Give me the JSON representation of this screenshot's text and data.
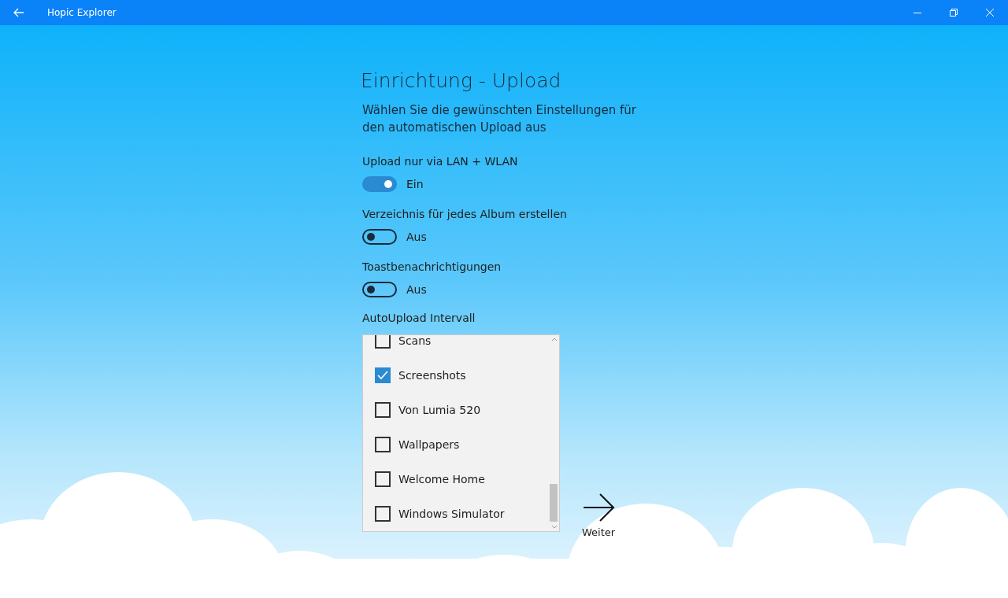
{
  "window": {
    "title": "Hopic Explorer"
  },
  "heading": "Einrichtung - Upload",
  "subtitle": "Wählen Sie die gewünschten Einstellungen für den automatischen Upload aus",
  "toggles": [
    {
      "label": "Upload nur via LAN + WLAN",
      "on": true,
      "state_text": "Ein"
    },
    {
      "label": "Verzeichnis für jedes Album erstellen",
      "on": false,
      "state_text": "Aus"
    },
    {
      "label": "Toastbenachrichtigungen",
      "on": false,
      "state_text": "Aus"
    }
  ],
  "interval": {
    "label": "AutoUpload Intervall",
    "items": [
      {
        "label": "Scans",
        "checked": false
      },
      {
        "label": "Screenshots",
        "checked": true
      },
      {
        "label": "Von Lumia 520",
        "checked": false
      },
      {
        "label": "Wallpapers",
        "checked": false
      },
      {
        "label": "Welcome Home",
        "checked": false
      },
      {
        "label": "Windows Simulator",
        "checked": false
      }
    ]
  },
  "next_button": {
    "label": "Weiter"
  }
}
